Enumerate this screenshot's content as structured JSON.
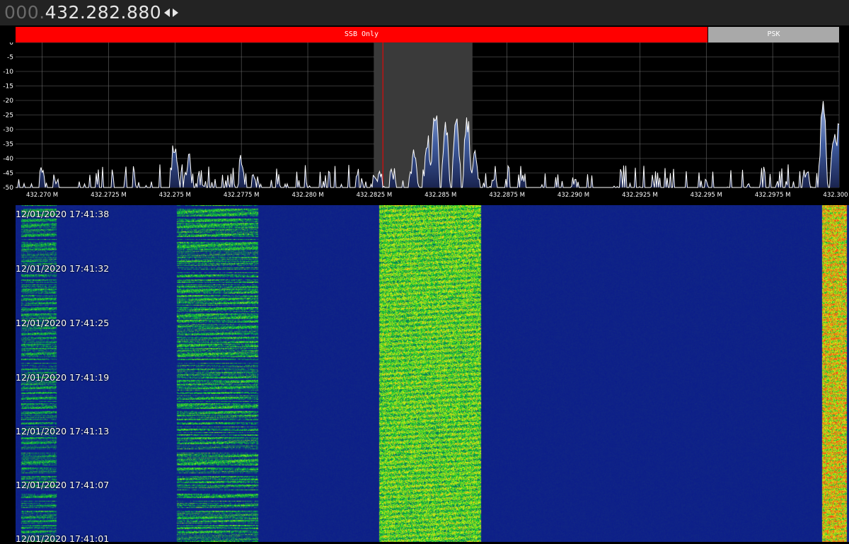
{
  "tuner": {
    "frequency_leading": "000.",
    "frequency_main": "432.282.880",
    "step_control_icon": "left-right-arrows-icon"
  },
  "bandplan": {
    "segments": [
      {
        "label": "SSB Only",
        "color": "#ff0000"
      },
      {
        "label": "PSK",
        "color": "#a9a9a9"
      }
    ]
  },
  "spectrum": {
    "db_ticks": [
      "0",
      "-5",
      "-10",
      "-15",
      "-20",
      "-25",
      "-30",
      "-35",
      "-40",
      "-45",
      "-50"
    ],
    "freq_ticks": [
      "432.270 M",
      "432.2725 M",
      "432.275 M",
      "432.2775 M",
      "432.280 M",
      "432.2825 M",
      "432.285 M",
      "432.2875 M",
      "432.290 M",
      "432.2925 M",
      "432.295 M",
      "432.2975 M",
      "432.300 M"
    ],
    "tuned_frequency": "432.282880",
    "filter_passband_low": "432.2825",
    "filter_passband_high": "432.2862",
    "trace_color": "#ffffff",
    "fill_color": "#3a5a9c"
  },
  "waterfall": {
    "timestamps": [
      "12/01/2020 17:41:38",
      "12/01/2020 17:41:32",
      "12/01/2020 17:41:25",
      "12/01/2020 17:41:19",
      "12/01/2020 17:41:13",
      "12/01/2020 17:41:07",
      "12/01/2020 17:41:01"
    ],
    "background_color": "#0a1a8c"
  },
  "chart_data": {
    "type": "line",
    "title": "",
    "xlabel": "",
    "ylabel": "",
    "x_range": [
      432.269,
      432.3
    ],
    "ylim": [
      -50,
      0
    ],
    "grid": true,
    "series": [
      {
        "x": [
          432.2692,
          432.27,
          432.2705,
          432.2715,
          432.2735,
          432.275,
          432.2755,
          432.276,
          432.277,
          432.2775,
          432.278,
          432.279,
          432.28,
          432.2815,
          432.2825,
          432.2832,
          432.284,
          432.2845,
          432.2848,
          432.2852,
          432.2856,
          432.286,
          432.2863,
          432.287,
          432.288,
          432.29,
          432.293,
          432.295,
          432.2965,
          432.298,
          432.2988,
          432.2994,
          432.2998,
          432.3
        ],
        "y": [
          -45,
          -42,
          -44,
          -47,
          -47,
          -31,
          -37,
          -44,
          -43,
          -37,
          -44,
          -46,
          -47,
          -47,
          -46,
          -42,
          -34,
          -31,
          -22,
          -27,
          -25,
          -24,
          -36,
          -43,
          -44,
          -46,
          -47,
          -47,
          -47,
          -47,
          -44,
          -20,
          -27,
          -26
        ]
      }
    ]
  }
}
